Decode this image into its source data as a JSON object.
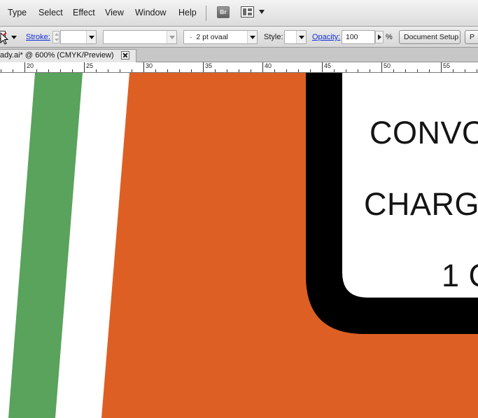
{
  "menu": {
    "items": [
      "Type",
      "Select",
      "Effect",
      "View",
      "Window",
      "Help"
    ],
    "bridge_label": "Br"
  },
  "control": {
    "stroke_label": "Stroke:",
    "stroke_weight": "",
    "brush_value": "",
    "profile_value": "2 pt ovaal",
    "style_label": "Style:",
    "opacity_label": "Opacity:",
    "opacity_value": "100",
    "opacity_unit": "%",
    "doc_setup_label": "Document Setup",
    "prefs_label": "P"
  },
  "document": {
    "tab_title": "ady.ai* @ 600% (CMYK/Preview)"
  },
  "ruler": {
    "labels": [
      "20",
      "25",
      "30",
      "35",
      "40",
      "45",
      "50",
      "55"
    ]
  },
  "artwork": {
    "sign_lines": [
      "CONVO",
      "CHARG",
      "1 C"
    ],
    "colors": {
      "green": "#59a35c",
      "orange": "#de5f24",
      "black": "#000000",
      "white": "#ffffff"
    }
  }
}
